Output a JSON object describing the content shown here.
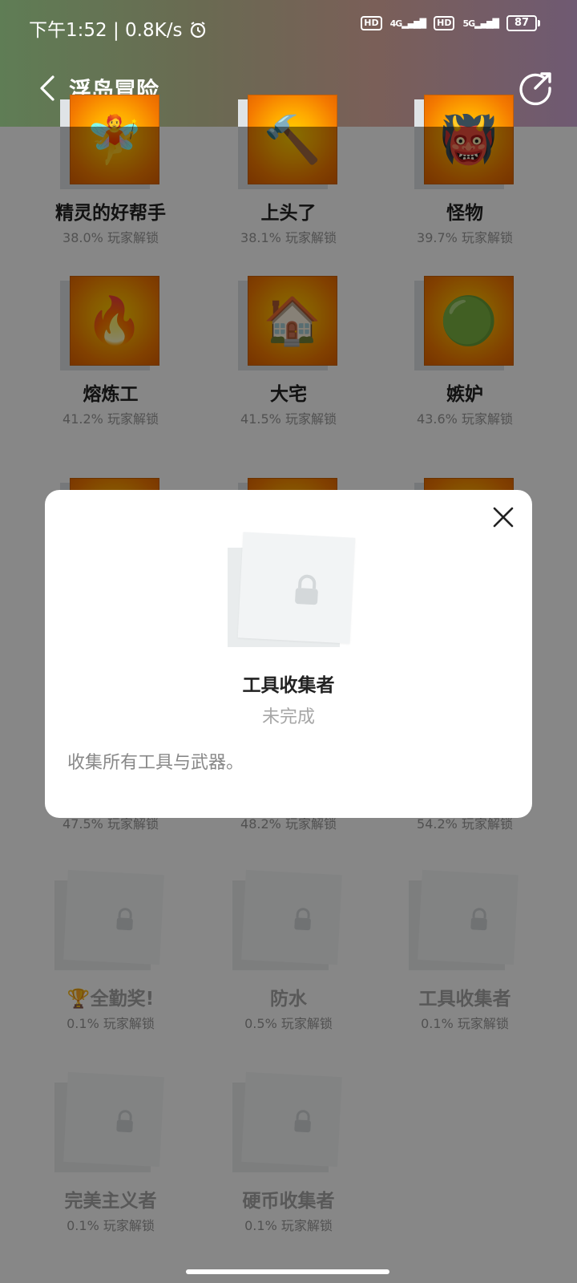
{
  "status_bar": {
    "time": "下午1:52",
    "net_speed": "0.8K/s",
    "hd1": "HD",
    "net1": "4G",
    "hd2": "HD",
    "net2": "5G",
    "battery": "87"
  },
  "header": {
    "title": "浮岛冒险"
  },
  "achievements": [
    {
      "name": "精灵的好帮手",
      "rate": "38.0% 玩家解锁",
      "icon": "fairy-helper-icon",
      "locked": false
    },
    {
      "name": "上头了",
      "rate": "38.1% 玩家解锁",
      "icon": "dizzy-icon",
      "locked": false
    },
    {
      "name": "怪物",
      "rate": "39.7% 玩家解锁",
      "icon": "monster-icon",
      "locked": false
    },
    {
      "name": "熔炼工",
      "rate": "41.2% 玩家解锁",
      "icon": "smelter-icon",
      "locked": false
    },
    {
      "name": "大宅",
      "rate": "41.5% 玩家解锁",
      "icon": "mansion-icon",
      "locked": false
    },
    {
      "name": "嫉妒",
      "rate": "43.6% 玩家解锁",
      "icon": "jealousy-slime-icon",
      "locked": false
    },
    {
      "name": "",
      "rate": "47.5% 玩家解锁",
      "icon": "badge-icon",
      "locked": false
    },
    {
      "name": "",
      "rate": "48.2% 玩家解锁",
      "icon": "badge-icon",
      "locked": false
    },
    {
      "name": "",
      "rate": "54.2% 玩家解锁",
      "icon": "badge-icon",
      "locked": false
    },
    {
      "name": "全勤奖!",
      "rate": "0.1% 玩家解锁",
      "icon": "lock-icon",
      "locked": true,
      "prefix_icon": "trophy-icon"
    },
    {
      "name": "防水",
      "rate": "0.5% 玩家解锁",
      "icon": "lock-icon",
      "locked": true
    },
    {
      "name": "工具收集者",
      "rate": "0.1% 玩家解锁",
      "icon": "lock-icon",
      "locked": true
    },
    {
      "name": "完美主义者",
      "rate": "0.1% 玩家解锁",
      "icon": "lock-icon",
      "locked": true
    },
    {
      "name": "硬币收集者",
      "rate": "0.1% 玩家解锁",
      "icon": "lock-icon",
      "locked": true
    }
  ],
  "modal": {
    "title": "工具收集者",
    "status": "未完成",
    "description": "收集所有工具与武器。"
  },
  "colors": {
    "badge_orange": "#f47a00",
    "overlay": "#000000",
    "text_primary": "#222222",
    "text_muted": "#a6a6a6"
  }
}
